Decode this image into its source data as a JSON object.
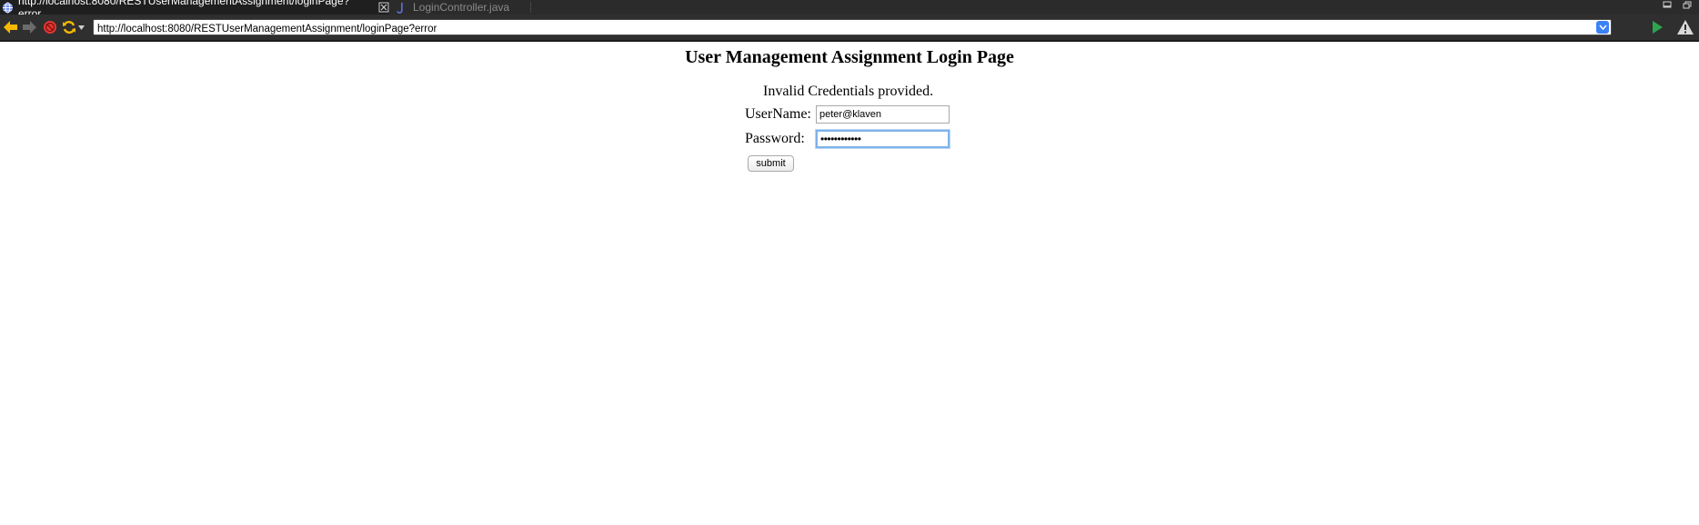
{
  "browser": {
    "tabs": [
      {
        "label": "http://localhost:8080/RESTUserManagementAssignment/loginPage?error",
        "active": true
      },
      {
        "label": "LoginController.java",
        "active": false
      }
    ],
    "url": "http://localhost:8080/RESTUserManagementAssignment/loginPage?error",
    "colors": {
      "chrome": "#2f2f2f",
      "back_arrow": "#f5b800",
      "stop": "#e53935",
      "refresh": "#f5b800",
      "run": "#2ea44f",
      "url_dropdown": "#3b82f6"
    }
  },
  "page": {
    "title": "User Management Assignment Login Page",
    "error": "Invalid Credentials provided.",
    "form": {
      "username_label": "UserName:",
      "username_value": "peter@klaven",
      "password_label": "Password:",
      "password_value": "••••••••••••",
      "submit_label": "submit"
    }
  },
  "icons": [
    "globe-icon",
    "close-tab-icon",
    "java-file-icon",
    "minimize-icon",
    "restore-icon",
    "back-icon",
    "forward-icon",
    "stop-icon",
    "refresh-icon",
    "dropdown-icon",
    "run-icon",
    "warning-icon"
  ]
}
